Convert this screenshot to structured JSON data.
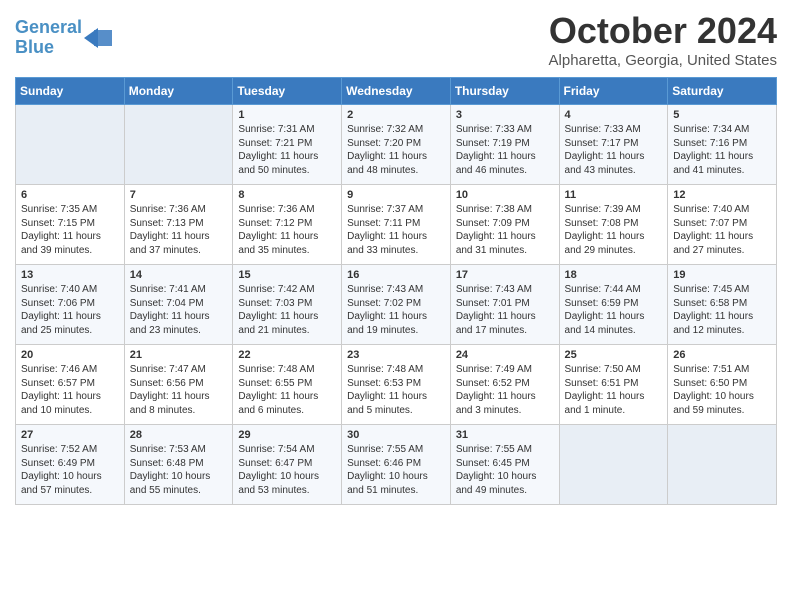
{
  "logo": {
    "line1": "General",
    "line2": "Blue"
  },
  "title": "October 2024",
  "location": "Alpharetta, Georgia, United States",
  "weekdays": [
    "Sunday",
    "Monday",
    "Tuesday",
    "Wednesday",
    "Thursday",
    "Friday",
    "Saturday"
  ],
  "weeks": [
    [
      {
        "day": "",
        "empty": true
      },
      {
        "day": "",
        "empty": true
      },
      {
        "day": "1",
        "sunrise": "7:31 AM",
        "sunset": "7:21 PM",
        "daylight": "11 hours and 50 minutes."
      },
      {
        "day": "2",
        "sunrise": "7:32 AM",
        "sunset": "7:20 PM",
        "daylight": "11 hours and 48 minutes."
      },
      {
        "day": "3",
        "sunrise": "7:33 AM",
        "sunset": "7:19 PM",
        "daylight": "11 hours and 46 minutes."
      },
      {
        "day": "4",
        "sunrise": "7:33 AM",
        "sunset": "7:17 PM",
        "daylight": "11 hours and 43 minutes."
      },
      {
        "day": "5",
        "sunrise": "7:34 AM",
        "sunset": "7:16 PM",
        "daylight": "11 hours and 41 minutes."
      }
    ],
    [
      {
        "day": "6",
        "sunrise": "7:35 AM",
        "sunset": "7:15 PM",
        "daylight": "11 hours and 39 minutes."
      },
      {
        "day": "7",
        "sunrise": "7:36 AM",
        "sunset": "7:13 PM",
        "daylight": "11 hours and 37 minutes."
      },
      {
        "day": "8",
        "sunrise": "7:36 AM",
        "sunset": "7:12 PM",
        "daylight": "11 hours and 35 minutes."
      },
      {
        "day": "9",
        "sunrise": "7:37 AM",
        "sunset": "7:11 PM",
        "daylight": "11 hours and 33 minutes."
      },
      {
        "day": "10",
        "sunrise": "7:38 AM",
        "sunset": "7:09 PM",
        "daylight": "11 hours and 31 minutes."
      },
      {
        "day": "11",
        "sunrise": "7:39 AM",
        "sunset": "7:08 PM",
        "daylight": "11 hours and 29 minutes."
      },
      {
        "day": "12",
        "sunrise": "7:40 AM",
        "sunset": "7:07 PM",
        "daylight": "11 hours and 27 minutes."
      }
    ],
    [
      {
        "day": "13",
        "sunrise": "7:40 AM",
        "sunset": "7:06 PM",
        "daylight": "11 hours and 25 minutes."
      },
      {
        "day": "14",
        "sunrise": "7:41 AM",
        "sunset": "7:04 PM",
        "daylight": "11 hours and 23 minutes."
      },
      {
        "day": "15",
        "sunrise": "7:42 AM",
        "sunset": "7:03 PM",
        "daylight": "11 hours and 21 minutes."
      },
      {
        "day": "16",
        "sunrise": "7:43 AM",
        "sunset": "7:02 PM",
        "daylight": "11 hours and 19 minutes."
      },
      {
        "day": "17",
        "sunrise": "7:43 AM",
        "sunset": "7:01 PM",
        "daylight": "11 hours and 17 minutes."
      },
      {
        "day": "18",
        "sunrise": "7:44 AM",
        "sunset": "6:59 PM",
        "daylight": "11 hours and 14 minutes."
      },
      {
        "day": "19",
        "sunrise": "7:45 AM",
        "sunset": "6:58 PM",
        "daylight": "11 hours and 12 minutes."
      }
    ],
    [
      {
        "day": "20",
        "sunrise": "7:46 AM",
        "sunset": "6:57 PM",
        "daylight": "11 hours and 10 minutes."
      },
      {
        "day": "21",
        "sunrise": "7:47 AM",
        "sunset": "6:56 PM",
        "daylight": "11 hours and 8 minutes."
      },
      {
        "day": "22",
        "sunrise": "7:48 AM",
        "sunset": "6:55 PM",
        "daylight": "11 hours and 6 minutes."
      },
      {
        "day": "23",
        "sunrise": "7:48 AM",
        "sunset": "6:53 PM",
        "daylight": "11 hours and 5 minutes."
      },
      {
        "day": "24",
        "sunrise": "7:49 AM",
        "sunset": "6:52 PM",
        "daylight": "11 hours and 3 minutes."
      },
      {
        "day": "25",
        "sunrise": "7:50 AM",
        "sunset": "6:51 PM",
        "daylight": "11 hours and 1 minute."
      },
      {
        "day": "26",
        "sunrise": "7:51 AM",
        "sunset": "6:50 PM",
        "daylight": "10 hours and 59 minutes."
      }
    ],
    [
      {
        "day": "27",
        "sunrise": "7:52 AM",
        "sunset": "6:49 PM",
        "daylight": "10 hours and 57 minutes."
      },
      {
        "day": "28",
        "sunrise": "7:53 AM",
        "sunset": "6:48 PM",
        "daylight": "10 hours and 55 minutes."
      },
      {
        "day": "29",
        "sunrise": "7:54 AM",
        "sunset": "6:47 PM",
        "daylight": "10 hours and 53 minutes."
      },
      {
        "day": "30",
        "sunrise": "7:55 AM",
        "sunset": "6:46 PM",
        "daylight": "10 hours and 51 minutes."
      },
      {
        "day": "31",
        "sunrise": "7:55 AM",
        "sunset": "6:45 PM",
        "daylight": "10 hours and 49 minutes."
      },
      {
        "day": "",
        "empty": true
      },
      {
        "day": "",
        "empty": true
      }
    ]
  ],
  "labels": {
    "sunrise": "Sunrise:",
    "sunset": "Sunset:",
    "daylight": "Daylight:"
  }
}
